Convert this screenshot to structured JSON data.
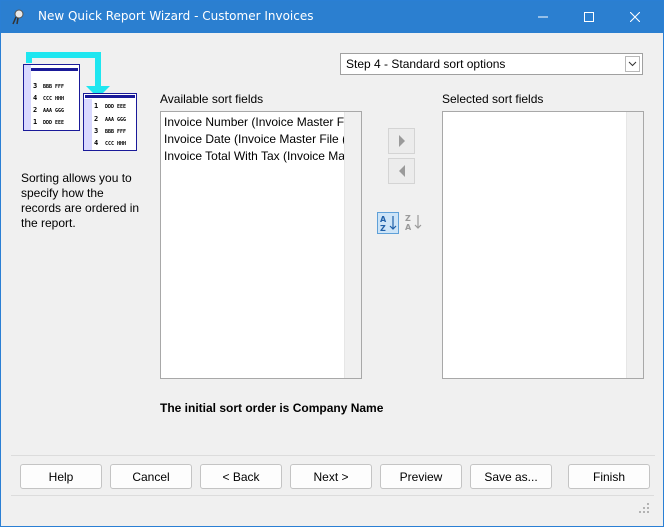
{
  "window": {
    "title": "New Quick Report Wizard - Customer Invoices",
    "title_bar_color": "#2b7fd0"
  },
  "step_select": {
    "value": "Step 4 - Standard sort options"
  },
  "illustration": {
    "back_rows": [
      {
        "num": "3",
        "text": "BBB FFF"
      },
      {
        "num": "4",
        "text": "CCC HHH"
      },
      {
        "num": "2",
        "text": "AAA GGG"
      },
      {
        "num": "1",
        "text": "DDD EEE"
      }
    ],
    "front_rows": [
      {
        "num": "1",
        "text": "DDD EEE"
      },
      {
        "num": "2",
        "text": "AAA GGG"
      },
      {
        "num": "3",
        "text": "BBB FFF"
      },
      {
        "num": "4",
        "text": "CCC HHH"
      }
    ]
  },
  "help_text": "Sorting allows you to specify how the records are ordered in the report.",
  "available": {
    "label": "Available sort fields",
    "items": [
      "Invoice Number (Invoice Master F",
      "Invoice Date (Invoice Master File (",
      "Invoice Total With Tax (Invoice Ma"
    ]
  },
  "selected": {
    "label": "Selected sort fields",
    "items": []
  },
  "note": "The initial sort order is Company Name",
  "buttons": {
    "help": "Help",
    "cancel": "Cancel",
    "back": "< Back",
    "next": "Next >",
    "preview": "Preview",
    "save_as": "Save as...",
    "finish": "Finish"
  }
}
